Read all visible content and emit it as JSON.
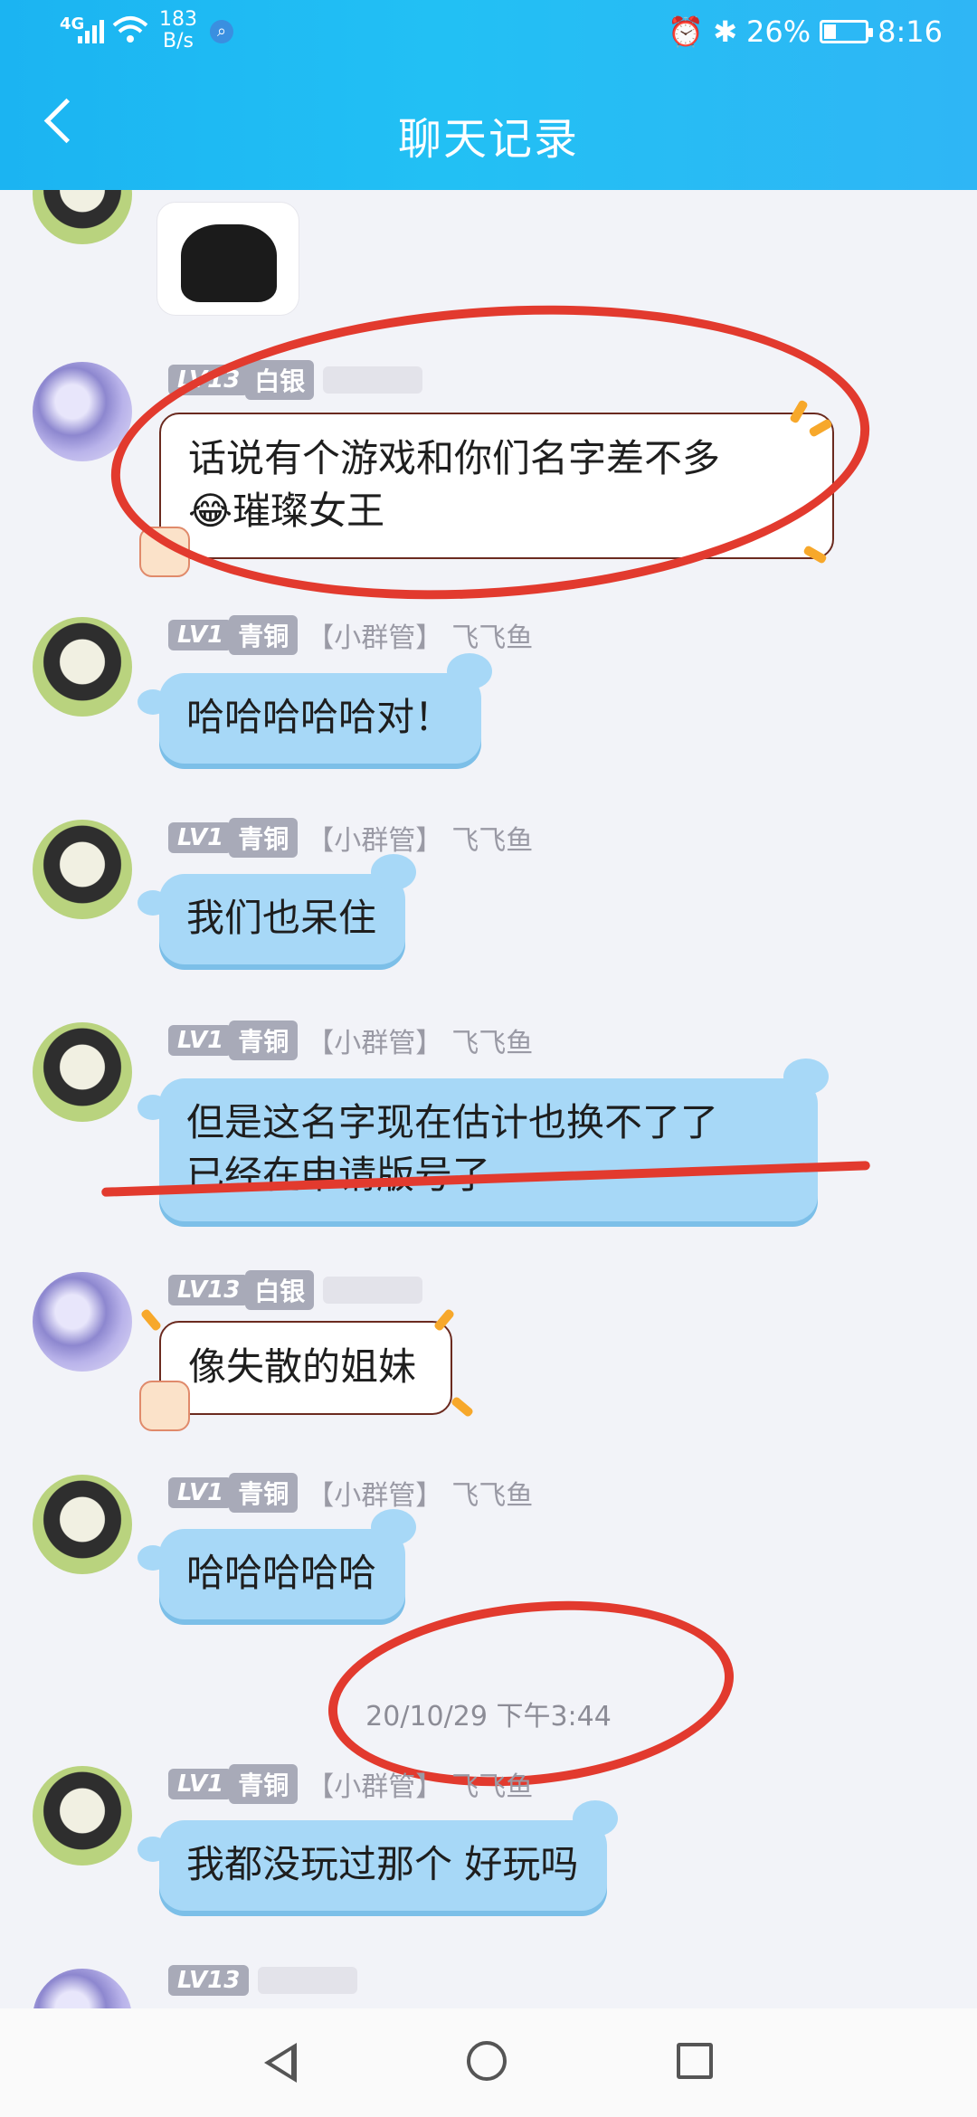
{
  "status_bar": {
    "network": "4G",
    "speed_value": "183",
    "speed_unit": "B/s",
    "battery": "26%",
    "time": "8:16"
  },
  "header": {
    "title": "聊天记录"
  },
  "messages": [
    {
      "sender_level": "LV1",
      "sender_rank": "青铜",
      "sender_role": "【小群管】",
      "sender_name": "飞飞鱼",
      "text": "哈哈哈哈哈对！"
    },
    {
      "sender_level": "LV1",
      "sender_rank": "青铜",
      "sender_role": "【小群管】",
      "sender_name": "飞飞鱼",
      "text": "我们也呆住"
    },
    {
      "sender_level": "LV1",
      "sender_rank": "青铜",
      "sender_role": "【小群管】",
      "sender_name": "飞飞鱼",
      "line1": "但是这名字现在估计也换不了了",
      "line2": "已经在申请版号了"
    },
    {
      "sender_level": "LV13",
      "sender_rank": "白银",
      "text": "像失散的姐妹"
    },
    {
      "sender_level": "LV1",
      "sender_rank": "青铜",
      "sender_role": "【小群管】",
      "sender_name": "飞飞鱼",
      "text": "哈哈哈哈哈"
    },
    {
      "sender_level": "LV1",
      "sender_rank": "青铜",
      "sender_role": "【小群管】",
      "sender_name": "飞飞鱼",
      "text": "我都没玩过那个 好玩吗"
    }
  ],
  "first_message": {
    "sender_level": "LV13",
    "sender_rank": "白银",
    "line1": "话说有个游戏和你们名字差不多",
    "emoji": "😂",
    "line2": "璀璨女王"
  },
  "timestamp": "20/10/29 下午3:44",
  "colors": {
    "header": "#1bb4f2",
    "bubble": "#a7d8f7",
    "marker": "#e23a2e"
  }
}
